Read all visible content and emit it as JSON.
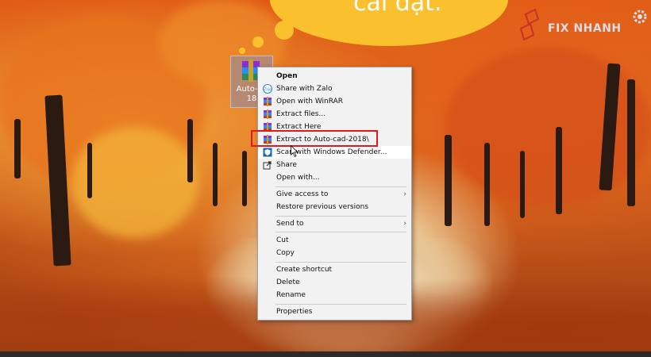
{
  "overlay": {
    "bubble_text": "cài đặt.",
    "brand_text": "FIX NHANH"
  },
  "desktop_icon": {
    "label_line1": "Auto-ca",
    "label_line2": "18",
    "icon": "winrar-archive-icon"
  },
  "context_menu": {
    "items": [
      {
        "label": "Open",
        "icon": "",
        "bold": true
      },
      {
        "label": "Share with Zalo",
        "icon": "zalo-icon"
      },
      {
        "label": "Open with WinRAR",
        "icon": "winrar-icon"
      },
      {
        "label": "Extract files...",
        "icon": "winrar-icon"
      },
      {
        "label": "Extract Here",
        "icon": "winrar-icon"
      },
      {
        "label": "Extract to Auto-cad-2018\\",
        "icon": "winrar-icon",
        "highlighted": true
      },
      {
        "label": "Scan with Windows Defender...",
        "icon": "defender-shield-icon",
        "hover": true
      },
      {
        "label": "Share",
        "icon": "share-icon"
      },
      {
        "label": "Open with...",
        "icon": ""
      },
      {
        "label": "Give access to",
        "icon": "",
        "submenu": true
      },
      {
        "label": "Restore previous versions",
        "icon": ""
      },
      {
        "label": "Send to",
        "icon": "",
        "submenu": true
      },
      {
        "label": "Cut",
        "icon": ""
      },
      {
        "label": "Copy",
        "icon": ""
      },
      {
        "label": "Create shortcut",
        "icon": ""
      },
      {
        "label": "Delete",
        "icon": ""
      },
      {
        "label": "Rename",
        "icon": ""
      },
      {
        "label": "Properties",
        "icon": ""
      }
    ],
    "submenu_arrow": "›"
  },
  "colors": {
    "highlight_border": "#e21a1a",
    "bubble": "#fbc02d",
    "menu_bg": "#f2f2f2"
  }
}
